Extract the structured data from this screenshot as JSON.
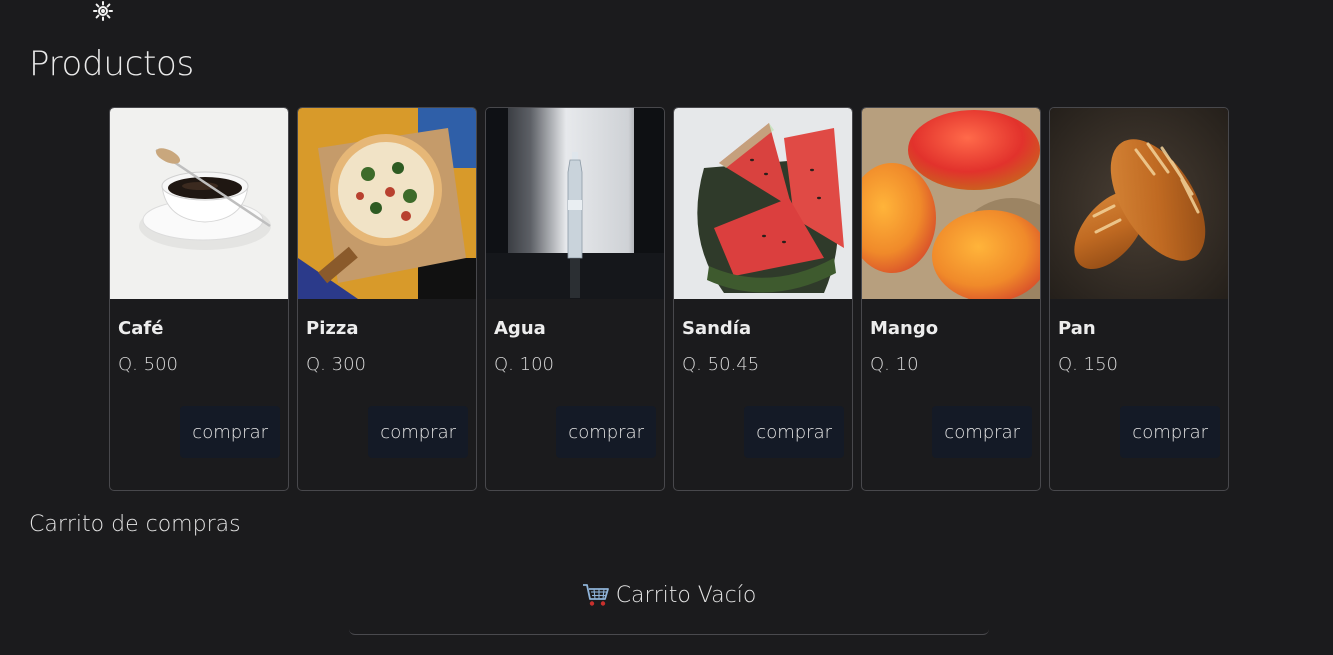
{
  "header": {
    "theme_icon": "sun-icon"
  },
  "page_title": "Productos",
  "products": [
    {
      "name": "Café",
      "price": "Q. 500",
      "button": "comprar",
      "image": "coffee-cup-image"
    },
    {
      "name": "Pizza",
      "price": "Q. 300",
      "button": "comprar",
      "image": "pizza-image"
    },
    {
      "name": "Agua",
      "price": "Q. 100",
      "button": "comprar",
      "image": "water-bottle-image"
    },
    {
      "name": "Sandía",
      "price": "Q. 50.45",
      "button": "comprar",
      "image": "watermelon-image"
    },
    {
      "name": "Mango",
      "price": "Q. 10",
      "button": "comprar",
      "image": "mango-image"
    },
    {
      "name": "Pan",
      "price": "Q. 150",
      "button": "comprar",
      "image": "bread-image"
    }
  ],
  "cart": {
    "title": "Carrito de compras",
    "empty_icon": "shopping-cart-icon",
    "empty_label": "Carrito Vacío"
  }
}
